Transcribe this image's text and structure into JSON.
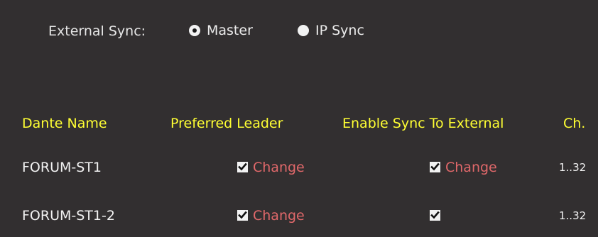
{
  "external_sync": {
    "label": "External Sync:",
    "options": [
      {
        "label": "Master",
        "selected": true
      },
      {
        "label": "IP Sync",
        "selected": false
      }
    ]
  },
  "table": {
    "headers": {
      "dante_name": "Dante Name",
      "preferred_leader": "Preferred Leader",
      "enable_sync": "Enable Sync To External",
      "channels": "Ch."
    },
    "rows": [
      {
        "dante_name": "FORUM-ST1",
        "preferred_leader_checked": true,
        "preferred_leader_action": "Change",
        "enable_sync_checked": true,
        "enable_sync_action": "Change",
        "channels": "1..32"
      },
      {
        "dante_name": "FORUM-ST1-2",
        "preferred_leader_checked": true,
        "preferred_leader_action": "Change",
        "enable_sync_checked": true,
        "enable_sync_action": "",
        "channels": "1..32"
      }
    ]
  },
  "colors": {
    "background": "#322f30",
    "header_text": "#ffff33",
    "link_text": "#e0686a",
    "body_text": "#f2f2f2"
  }
}
